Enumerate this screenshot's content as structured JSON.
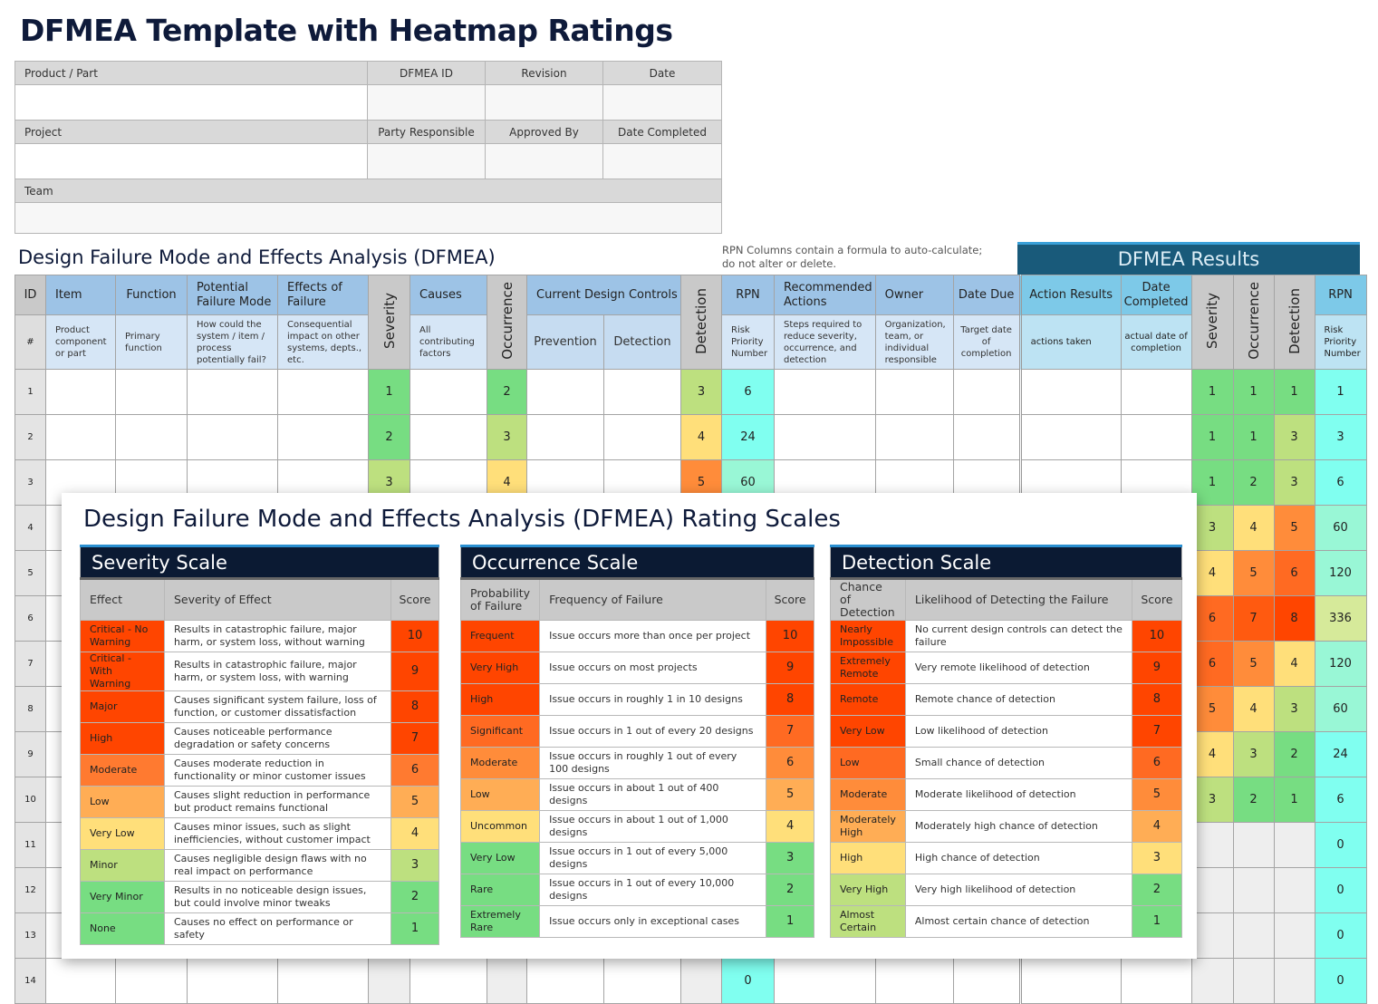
{
  "page_title": "DFMEA Template with Heatmap Ratings",
  "info": {
    "product_part": "Product / Part",
    "dfmea_id": "DFMEA ID",
    "revision": "Revision",
    "date": "Date",
    "project": "Project",
    "party_responsible": "Party Responsible",
    "approved_by": "Approved By",
    "date_completed": "Date Completed",
    "team": "Team"
  },
  "section_title": "Design Failure Mode and Effects Analysis (DFMEA)",
  "rpn_note_line1": "RPN Columns contain a formula to auto-calculate;",
  "rpn_note_line2": "do not alter or delete.",
  "results_title": "DFMEA Results",
  "headers": {
    "id": "ID",
    "id_sub": "#",
    "item": "Item",
    "item_sub": "Product component or part",
    "function": "Function",
    "function_sub": "Primary function",
    "failure_mode": "Potential Failure Mode",
    "failure_mode_sub": "How could the system / item / process potentially fail?",
    "effects": "Effects of Failure",
    "effects_sub": "Consequential impact on other systems, depts., etc.",
    "severity": "Severity",
    "causes": "Causes",
    "causes_sub": "All contributing factors",
    "occurrence": "Occurrence",
    "controls": "Current Design Controls",
    "prevention": "Prevention",
    "detection_ctrl": "Detection",
    "detection": "Detection",
    "rpn": "RPN",
    "rpn_sub": "Risk Priority Number",
    "recommended": "Recommended Actions",
    "recommended_sub": "Steps required to reduce severity, occurrence, and detection",
    "owner": "Owner",
    "owner_sub": "Organization, team, or individual responsible",
    "date_due": "Date Due",
    "date_due_sub": "Target date of completion",
    "action_results": "Action Results",
    "action_results_sub": "actions taken",
    "date_completed": "Date Completed",
    "date_completed_sub": "actual date of completion",
    "r_severity": "Severity",
    "r_occurrence": "Occurrence",
    "r_detection": "Detection",
    "r_rpn": "RPN",
    "r_rpn_sub": "Risk Priority Number"
  },
  "rows": [
    {
      "id": "1",
      "sev": "1",
      "occ": "2",
      "det": "3",
      "rpn": "6",
      "rsev": "1",
      "rocc": "1",
      "rdet": "1",
      "rrpn": "1"
    },
    {
      "id": "2",
      "sev": "2",
      "occ": "3",
      "det": "4",
      "rpn": "24",
      "rsev": "1",
      "rocc": "1",
      "rdet": "3",
      "rrpn": "3"
    },
    {
      "id": "3",
      "sev": "3",
      "occ": "4",
      "det": "5",
      "rpn": "60",
      "rsev": "1",
      "rocc": "2",
      "rdet": "3",
      "rrpn": "6"
    },
    {
      "id": "4",
      "sev": "",
      "occ": "",
      "det": "",
      "rpn": "",
      "rsev": "3",
      "rocc": "4",
      "rdet": "5",
      "rrpn": "60"
    },
    {
      "id": "5",
      "sev": "",
      "occ": "",
      "det": "",
      "rpn": "",
      "rsev": "4",
      "rocc": "5",
      "rdet": "6",
      "rrpn": "120"
    },
    {
      "id": "6",
      "sev": "",
      "occ": "",
      "det": "",
      "rpn": "",
      "rsev": "6",
      "rocc": "7",
      "rdet": "8",
      "rrpn": "336"
    },
    {
      "id": "7",
      "sev": "",
      "occ": "",
      "det": "",
      "rpn": "",
      "rsev": "6",
      "rocc": "5",
      "rdet": "4",
      "rrpn": "120"
    },
    {
      "id": "8",
      "sev": "",
      "occ": "",
      "det": "",
      "rpn": "",
      "rsev": "5",
      "rocc": "4",
      "rdet": "3",
      "rrpn": "60"
    },
    {
      "id": "9",
      "sev": "",
      "occ": "",
      "det": "",
      "rpn": "",
      "rsev": "4",
      "rocc": "3",
      "rdet": "2",
      "rrpn": "24"
    },
    {
      "id": "10",
      "sev": "",
      "occ": "",
      "det": "",
      "rpn": "",
      "rsev": "3",
      "rocc": "2",
      "rdet": "1",
      "rrpn": "6"
    },
    {
      "id": "11",
      "sev": "",
      "occ": "",
      "det": "",
      "rpn": "",
      "rsev": "",
      "rocc": "",
      "rdet": "",
      "rrpn": "0"
    },
    {
      "id": "12",
      "sev": "",
      "occ": "",
      "det": "",
      "rpn": "",
      "rsev": "",
      "rocc": "",
      "rdet": "",
      "rrpn": "0"
    },
    {
      "id": "13",
      "sev": "",
      "occ": "",
      "det": "",
      "rpn": "",
      "rsev": "",
      "rocc": "",
      "rdet": "",
      "rrpn": "0"
    },
    {
      "id": "14",
      "sev": "",
      "occ": "",
      "det": "",
      "rpn": "0",
      "rsev": "",
      "rocc": "",
      "rdet": "",
      "rrpn": "0"
    }
  ],
  "colors": {
    "heat": {
      "1": "#77dd82",
      "2": "#77dd82",
      "3": "#bde07f",
      "4": "#ffdf7a",
      "5": "#ff8c3a",
      "6": "#ff6a22",
      "7": "#ff5a10",
      "8": "#ff4500",
      "9": "#ff4500",
      "10": "#ff4500"
    },
    "rpn_low": "#80fff0",
    "rpn_mid": "#99f7d6",
    "rpn_high": "#d6ea9a"
  },
  "rating_scales": {
    "title": "Design Failure Mode and Effects Analysis (DFMEA) Rating Scales",
    "severity": {
      "title": "Severity Scale",
      "col1": "Effect",
      "col2": "Severity of Effect",
      "col3": "Score",
      "rows": [
        {
          "label": "Critical - No Warning",
          "desc": "Results in catastrophic failure, major harm, or system loss, without warning",
          "score": "10",
          "color": "#ff4500"
        },
        {
          "label": "Critical - With Warning",
          "desc": "Results in catastrophic failure, major harm, or system loss, with warning",
          "score": "9",
          "color": "#ff4500"
        },
        {
          "label": "Major",
          "desc": "Causes significant system failure, loss of function, or customer dissatisfaction",
          "score": "8",
          "color": "#ff4500"
        },
        {
          "label": "High",
          "desc": "Causes noticeable performance degradation or safety concerns",
          "score": "7",
          "color": "#ff4500"
        },
        {
          "label": "Moderate",
          "desc": "Causes moderate reduction in functionality or minor customer issues",
          "score": "6",
          "color": "#ff7a30"
        },
        {
          "label": "Low",
          "desc": "Causes slight reduction in performance but product remains functional",
          "score": "5",
          "color": "#ffad55"
        },
        {
          "label": "Very Low",
          "desc": "Causes minor issues, such as slight inefficiencies, without customer impact",
          "score": "4",
          "color": "#ffdf7a"
        },
        {
          "label": "Minor",
          "desc": "Causes negligible design flaws with no real impact on performance",
          "score": "3",
          "color": "#bde07f"
        },
        {
          "label": "Very Minor",
          "desc": "Results in no noticeable design issues, but could involve minor tweaks",
          "score": "2",
          "color": "#77dd82"
        },
        {
          "label": "None",
          "desc": "Causes no effect on performance or safety",
          "score": "1",
          "color": "#77dd82"
        }
      ]
    },
    "occurrence": {
      "title": "Occurrence Scale",
      "col1": "Probability of Failure",
      "col2": "Frequency of Failure",
      "col3": "Score",
      "rows": [
        {
          "label": "Frequent",
          "desc": "Issue occurs more than once per project",
          "score": "10",
          "color": "#ff4500"
        },
        {
          "label": "Very High",
          "desc": "Issue occurs on most projects",
          "score": "9",
          "color": "#ff4500"
        },
        {
          "label": "High",
          "desc": "Issue occurs in roughly 1 in 10 designs",
          "score": "8",
          "color": "#ff4500"
        },
        {
          "label": "Significant",
          "desc": "Issue occurs in 1 out of every 20 designs",
          "score": "7",
          "color": "#ff6a22"
        },
        {
          "label": "Moderate",
          "desc": "Issue occurs in roughly 1 out of every 100 designs",
          "score": "6",
          "color": "#ff8c3a"
        },
        {
          "label": "Low",
          "desc": "Issue occurs in about 1 out of 400 designs",
          "score": "5",
          "color": "#ffad55"
        },
        {
          "label": "Uncommon",
          "desc": "Issue occurs in about 1 out of 1,000 designs",
          "score": "4",
          "color": "#ffdf7a"
        },
        {
          "label": "Very Low",
          "desc": "Issue occurs in 1 out of every 5,000 designs",
          "score": "3",
          "color": "#77dd82"
        },
        {
          "label": "Rare",
          "desc": "Issue occurs in 1 out of every 10,000 designs",
          "score": "2",
          "color": "#77dd82"
        },
        {
          "label": "Extremely Rare",
          "desc": "Issue occurs only in exceptional cases",
          "score": "1",
          "color": "#77dd82"
        }
      ]
    },
    "detection": {
      "title": "Detection Scale",
      "col1": "Chance of Detection",
      "col2": "Likelihood of Detecting the Failure",
      "col3": "Score",
      "rows": [
        {
          "label": "Nearly Impossible",
          "desc": "No current design controls can detect the failure",
          "score": "10",
          "color": "#ff4500"
        },
        {
          "label": "Extremely Remote",
          "desc": "Very remote likelihood of detection",
          "score": "9",
          "color": "#ff4500"
        },
        {
          "label": "Remote",
          "desc": "Remote chance of detection",
          "score": "8",
          "color": "#ff4500"
        },
        {
          "label": "Very Low",
          "desc": "Low likelihood of detection",
          "score": "7",
          "color": "#ff4500"
        },
        {
          "label": "Low",
          "desc": "Small chance of detection",
          "score": "6",
          "color": "#ff6a22"
        },
        {
          "label": "Moderate",
          "desc": "Moderate likelihood of detection",
          "score": "5",
          "color": "#ff8c3a"
        },
        {
          "label": "Moderately High",
          "desc": "Moderately high chance of detection",
          "score": "4",
          "color": "#ffad55"
        },
        {
          "label": "High",
          "desc": "High chance of detection",
          "score": "3",
          "color": "#ffdf7a"
        },
        {
          "label": "Very High",
          "desc": "Very high likelihood of detection",
          "score": "2",
          "color": "#bde07f",
          "score_color": "#77dd82"
        },
        {
          "label": "Almost Certain",
          "desc": "Almost certain chance of detection",
          "score": "1",
          "color": "#bde07f",
          "score_color": "#77dd82"
        }
      ]
    }
  }
}
